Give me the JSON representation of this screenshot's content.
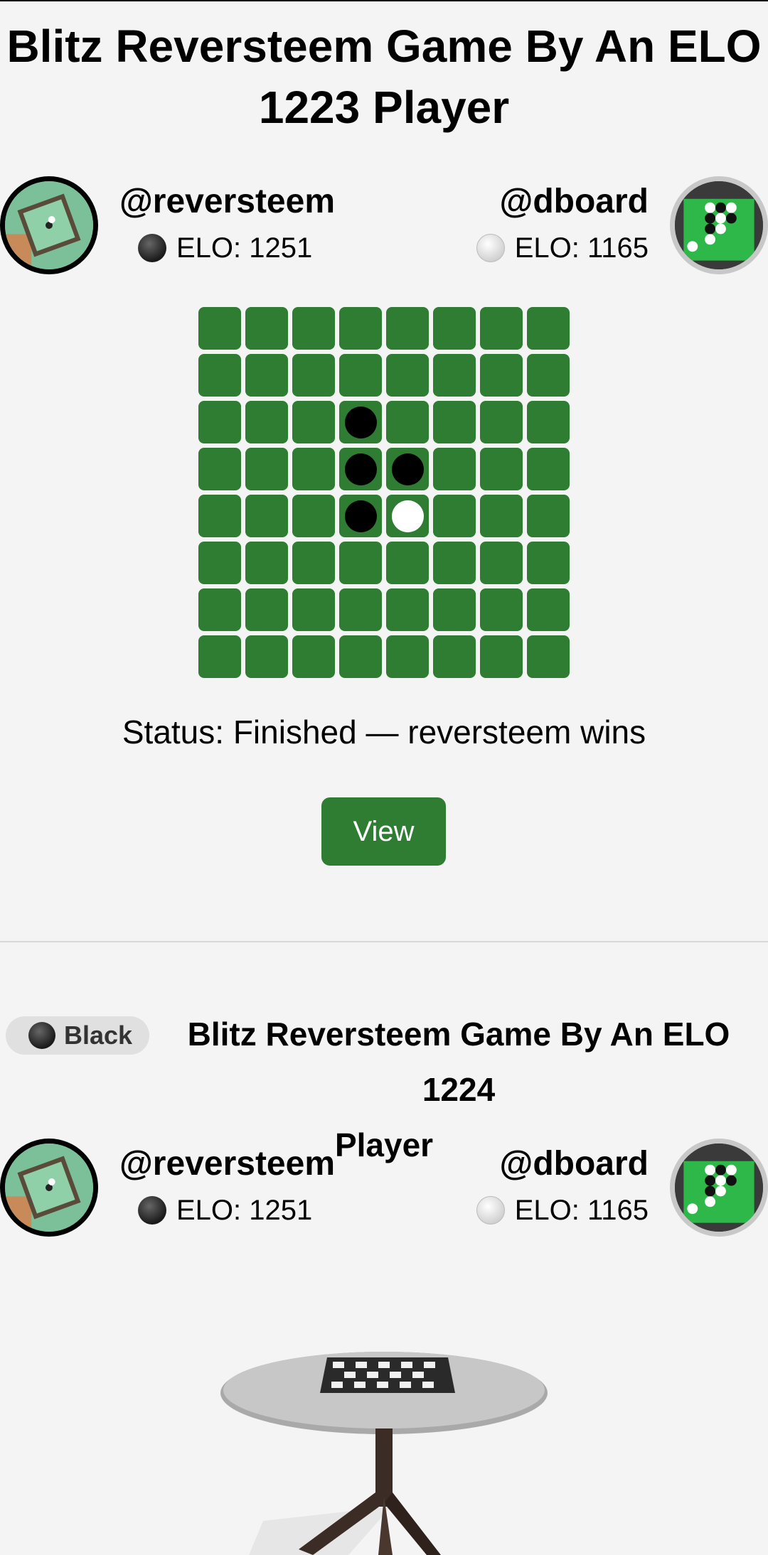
{
  "games": [
    {
      "title": "Blitz Reversteem Game By An ELO 1223 Player",
      "players": {
        "black": {
          "name": "@reversteem",
          "elo": "ELO: 1251"
        },
        "white": {
          "name": "@dboard",
          "elo": "ELO: 1165"
        }
      },
      "board": {
        "rows": [
          "........",
          "........",
          "...B....",
          "...BB...",
          "...BW...",
          "........",
          "........",
          "........"
        ],
        "cell_color": "#2e7d32"
      },
      "status": "Status: Finished — reversteem wins",
      "view_label": "View"
    },
    {
      "badge": "Black",
      "title_line1": "Blitz Reversteem Game By An ELO 1224",
      "title_line2": "Player",
      "players": {
        "black": {
          "name": "@reversteem",
          "elo": "ELO: 1251"
        },
        "white": {
          "name": "@dboard",
          "elo": "ELO: 1165"
        }
      }
    }
  ],
  "colors": {
    "accent": "#2e7d32",
    "background": "#f4f4f4",
    "divider": "#d8d8d8"
  }
}
